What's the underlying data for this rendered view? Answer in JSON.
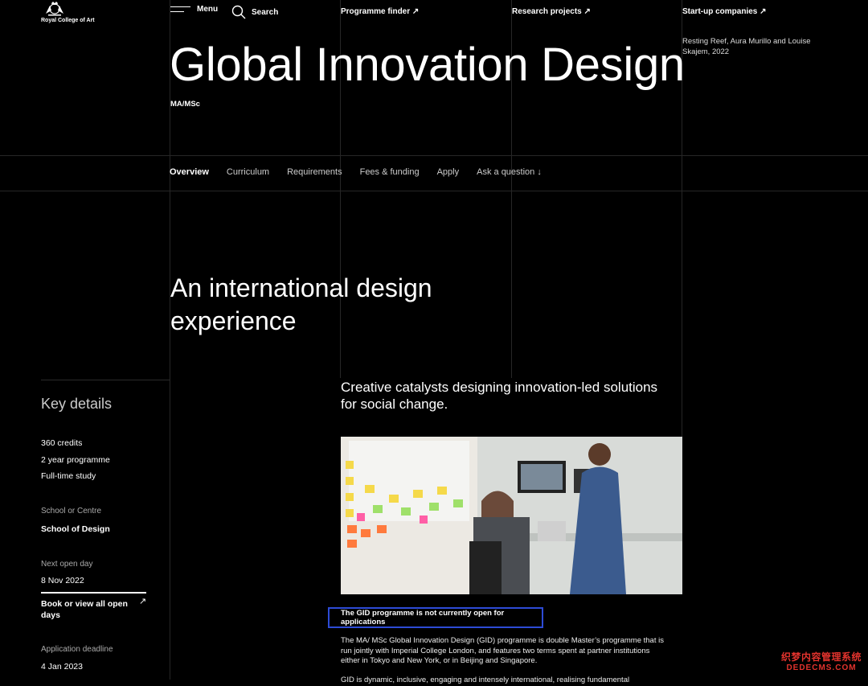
{
  "header": {
    "logo_text": "Royal College of Art",
    "menu_label": "Menu",
    "search_label": "Search",
    "links": [
      {
        "label": "Programme finder ↗"
      },
      {
        "label": "Research projects ↗"
      },
      {
        "label": "Start-up companies ↗"
      }
    ],
    "image_caption": "Resting Reef, Aura Murillo and Louise Skajem, 2022"
  },
  "hero": {
    "title": "Global Innovation Design",
    "subtitle": "MA/MSc"
  },
  "tabs": [
    {
      "label": "Overview",
      "active": true
    },
    {
      "label": "Curriculum"
    },
    {
      "label": "Requirements"
    },
    {
      "label": "Fees & funding"
    },
    {
      "label": "Apply"
    },
    {
      "label": "Ask a question  ↓"
    }
  ],
  "intro": {
    "heading": "An international design experience",
    "lead": "Creative catalysts designing innovation-led solutions for social change."
  },
  "key_details": {
    "title": "Key details",
    "items": [
      "360 credits",
      "2 year programme",
      "Full-time study"
    ],
    "school_label": "School or Centre",
    "school_value": "School of Design",
    "open_day_label": "Next open day",
    "open_day_value": "8 Nov 2022",
    "book_link": "Book or view all open days",
    "book_arrow": "↗",
    "deadline_label": "Application deadline",
    "deadline_value": "4 Jan 2023"
  },
  "notice": "The GID programme is not currently open for applications",
  "body": {
    "paragraph1": "The MA/ MSc Global Innovation Design (GID) programme is double Master’s programme that is run jointly with Imperial College London, and features two terms spent at partner institutions either in Tokyo and New York, or in Beijing and Singapore.",
    "paragraph2": "GID is dynamic, inclusive, engaging and intensely international, realising fundamental"
  },
  "watermark": {
    "line1": "织梦内容管理系统",
    "line2": "DEDECMS.COM"
  },
  "colors": {
    "background": "#000000",
    "text": "#ffffff",
    "notice_border": "#2d4bd6",
    "watermark": "#e2332d"
  }
}
